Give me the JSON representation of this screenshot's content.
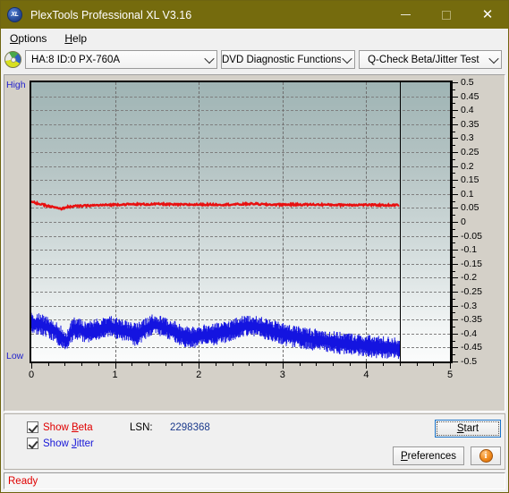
{
  "window": {
    "title": "PlexTools Professional XL V3.16",
    "icon": "XL",
    "icon_name": "app-icon",
    "minimize": "—",
    "maximize": "□",
    "close": "✕"
  },
  "menu": {
    "items": [
      {
        "label": "Options",
        "accel": "O"
      },
      {
        "label": "Help",
        "accel": "H"
      }
    ]
  },
  "toolbar": {
    "drive_icon": "disc-icon",
    "drive": {
      "value": "HA:8 ID:0  PX-760A"
    },
    "function": {
      "value": "DVD Diagnostic Functions"
    },
    "test": {
      "value": "Q-Check Beta/Jitter Test"
    }
  },
  "chart_labels": {
    "high": "High",
    "low": "Low"
  },
  "controls": {
    "show_beta": {
      "label": "Show Beta",
      "accel": "B",
      "checked": true,
      "color": "#e00000"
    },
    "show_jitter": {
      "label": "Show Jitter",
      "accel": "J",
      "checked": true,
      "color": "#1818d8"
    },
    "lsn_label": "LSN:",
    "lsn_value": "2298368",
    "start": {
      "label": "Start",
      "accel": "S"
    },
    "preferences": {
      "label": "Preferences",
      "accel": "P"
    },
    "info": {
      "label": "i"
    }
  },
  "statusbar": {
    "text": "Ready"
  },
  "chart_data": {
    "type": "line",
    "title": "Q-Check Beta/Jitter Test",
    "xlabel": "",
    "ylabel": "",
    "xlim": [
      0,
      5
    ],
    "ylim": [
      -0.5,
      0.5
    ],
    "grid": true,
    "legend_position": "bottom-left",
    "xticks": [
      0,
      1,
      2,
      3,
      4,
      5
    ],
    "yticks": [
      0.5,
      0.45,
      0.4,
      0.35,
      0.3,
      0.25,
      0.2,
      0.15,
      0.1,
      0.05,
      0,
      -0.05,
      -0.1,
      -0.15,
      -0.2,
      -0.25,
      -0.3,
      -0.35,
      -0.4,
      -0.45,
      -0.5
    ],
    "axis_top_label": "High",
    "axis_bottom_label": "Low",
    "data_end_x": 4.4,
    "series": [
      {
        "name": "Beta",
        "color": "#e81010",
        "x": [
          0.0,
          0.1,
          0.2,
          0.3,
          0.35,
          0.42,
          0.5,
          0.6,
          0.72,
          0.85,
          1.0,
          1.2,
          1.4,
          1.55,
          1.7,
          1.9,
          2.1,
          2.3,
          2.5,
          2.65,
          2.8,
          3.0,
          3.2,
          3.4,
          3.6,
          3.8,
          4.0,
          4.2,
          4.4
        ],
        "values": [
          0.072,
          0.064,
          0.057,
          0.05,
          0.046,
          0.053,
          0.056,
          0.057,
          0.059,
          0.06,
          0.062,
          0.063,
          0.063,
          0.064,
          0.062,
          0.062,
          0.062,
          0.062,
          0.063,
          0.065,
          0.062,
          0.062,
          0.062,
          0.062,
          0.061,
          0.061,
          0.061,
          0.06,
          0.06
        ]
      },
      {
        "name": "Jitter",
        "color": "#1414e0",
        "x": [
          0.0,
          0.1,
          0.2,
          0.28,
          0.36,
          0.42,
          0.5,
          0.58,
          0.65,
          0.75,
          0.85,
          0.95,
          1.05,
          1.15,
          1.25,
          1.35,
          1.45,
          1.55,
          1.65,
          1.78,
          1.9,
          2.05,
          2.2,
          2.35,
          2.5,
          2.62,
          2.75,
          2.9,
          3.05,
          3.2,
          3.35,
          3.5,
          3.65,
          3.8,
          3.95,
          4.1,
          4.25,
          4.4
        ],
        "upper": [
          -0.33,
          -0.332,
          -0.345,
          -0.355,
          -0.375,
          -0.395,
          -0.345,
          -0.35,
          -0.362,
          -0.355,
          -0.345,
          -0.342,
          -0.35,
          -0.358,
          -0.368,
          -0.352,
          -0.335,
          -0.34,
          -0.352,
          -0.368,
          -0.382,
          -0.372,
          -0.368,
          -0.358,
          -0.342,
          -0.338,
          -0.345,
          -0.358,
          -0.37,
          -0.378,
          -0.385,
          -0.392,
          -0.398,
          -0.402,
          -0.408,
          -0.412,
          -0.415,
          -0.418
        ],
        "lower": [
          -0.392,
          -0.4,
          -0.412,
          -0.425,
          -0.448,
          -0.462,
          -0.418,
          -0.42,
          -0.43,
          -0.424,
          -0.412,
          -0.408,
          -0.418,
          -0.428,
          -0.44,
          -0.42,
          -0.4,
          -0.405,
          -0.42,
          -0.438,
          -0.45,
          -0.442,
          -0.438,
          -0.428,
          -0.408,
          -0.402,
          -0.412,
          -0.428,
          -0.44,
          -0.448,
          -0.455,
          -0.462,
          -0.468,
          -0.472,
          -0.478,
          -0.482,
          -0.486,
          -0.49
        ]
      }
    ]
  }
}
